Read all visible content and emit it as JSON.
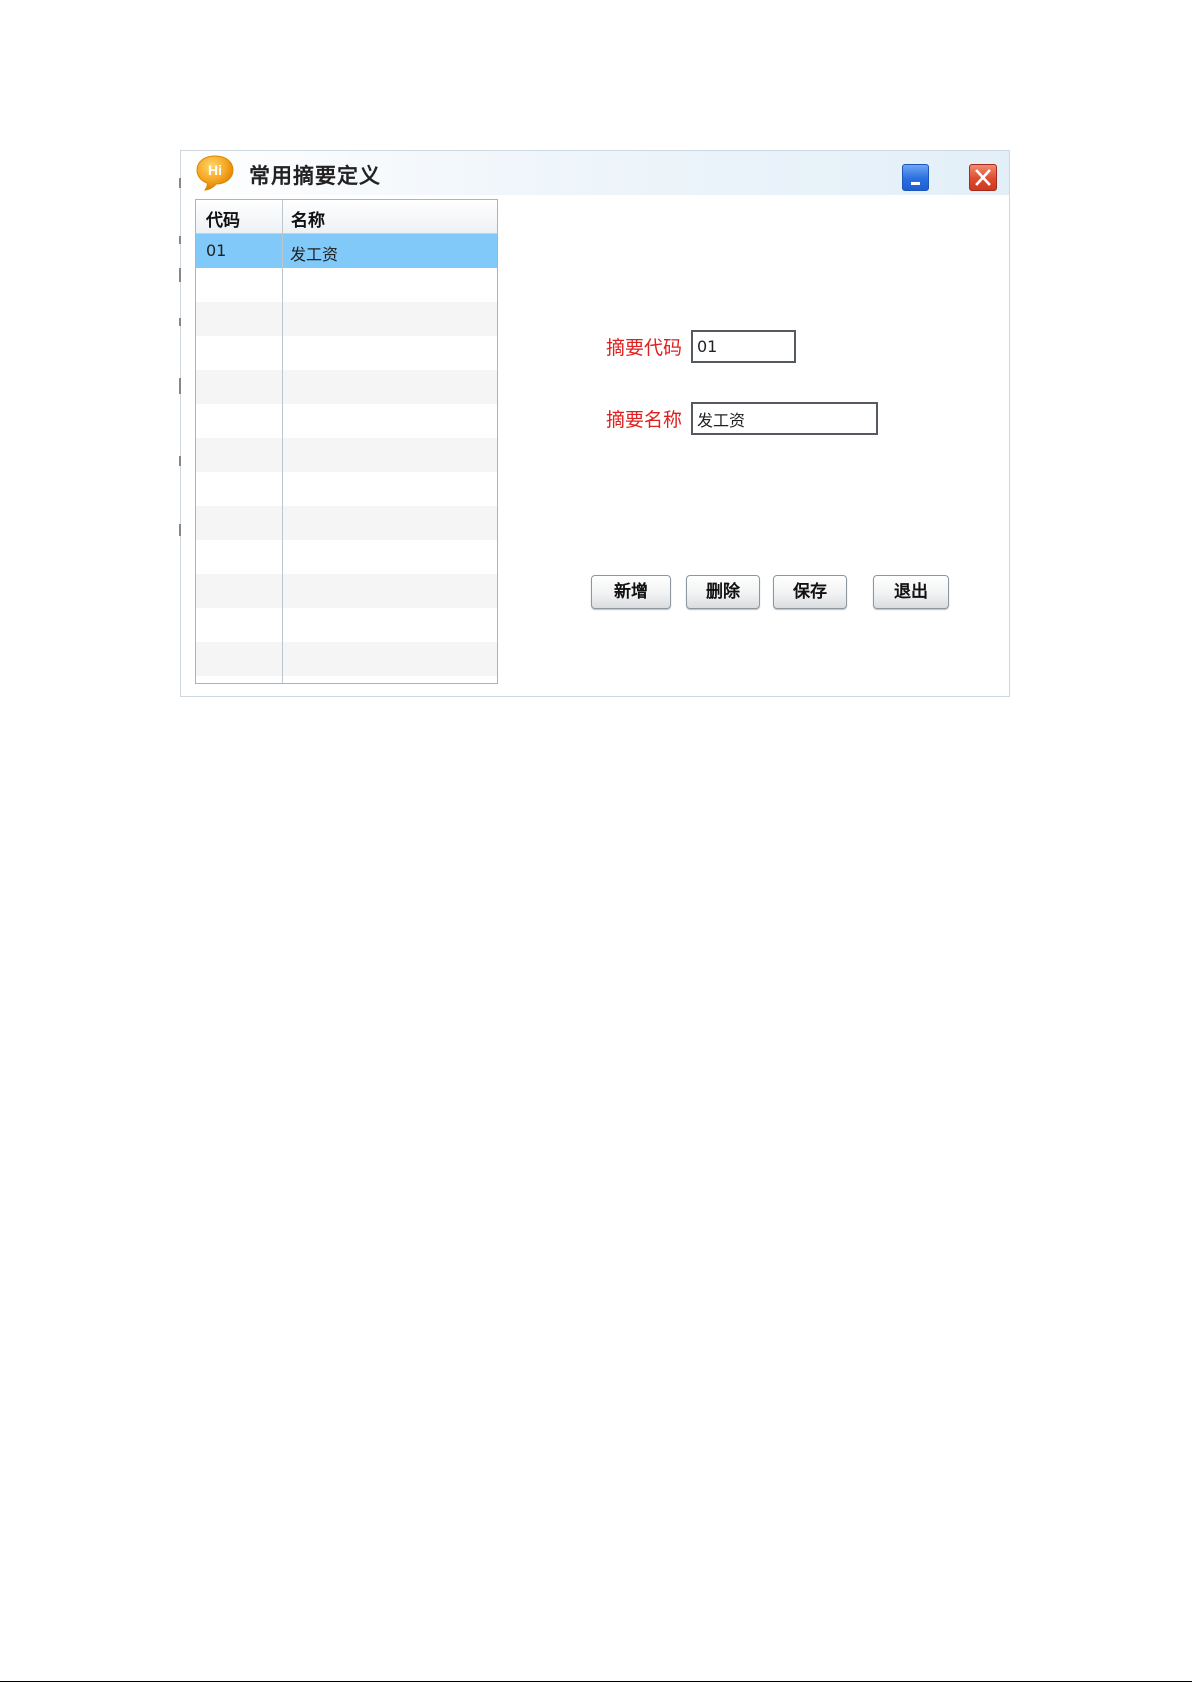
{
  "window": {
    "title": "常用摘要定义",
    "app_icon_text": "Hi"
  },
  "grid": {
    "columns": [
      "代码",
      "名称"
    ],
    "rows": [
      {
        "code": "01",
        "name": "发工资",
        "selected": true
      }
    ]
  },
  "form": {
    "code_label": "摘要代码",
    "code_value": "01",
    "name_label": "摘要名称",
    "name_value": "发工资"
  },
  "buttons": {
    "add": "新增",
    "delete": "删除",
    "save": "保存",
    "exit": "退出"
  },
  "colors": {
    "selected_row": "#80c9f9",
    "required_label": "#e02020",
    "minimize_button": "#2a6fe0",
    "close_button": "#de4b2d",
    "app_icon": "#f39c12"
  },
  "icons": {
    "app": "hi-chat-bubble-icon",
    "minimize": "minimize-icon",
    "close": "close-icon"
  }
}
